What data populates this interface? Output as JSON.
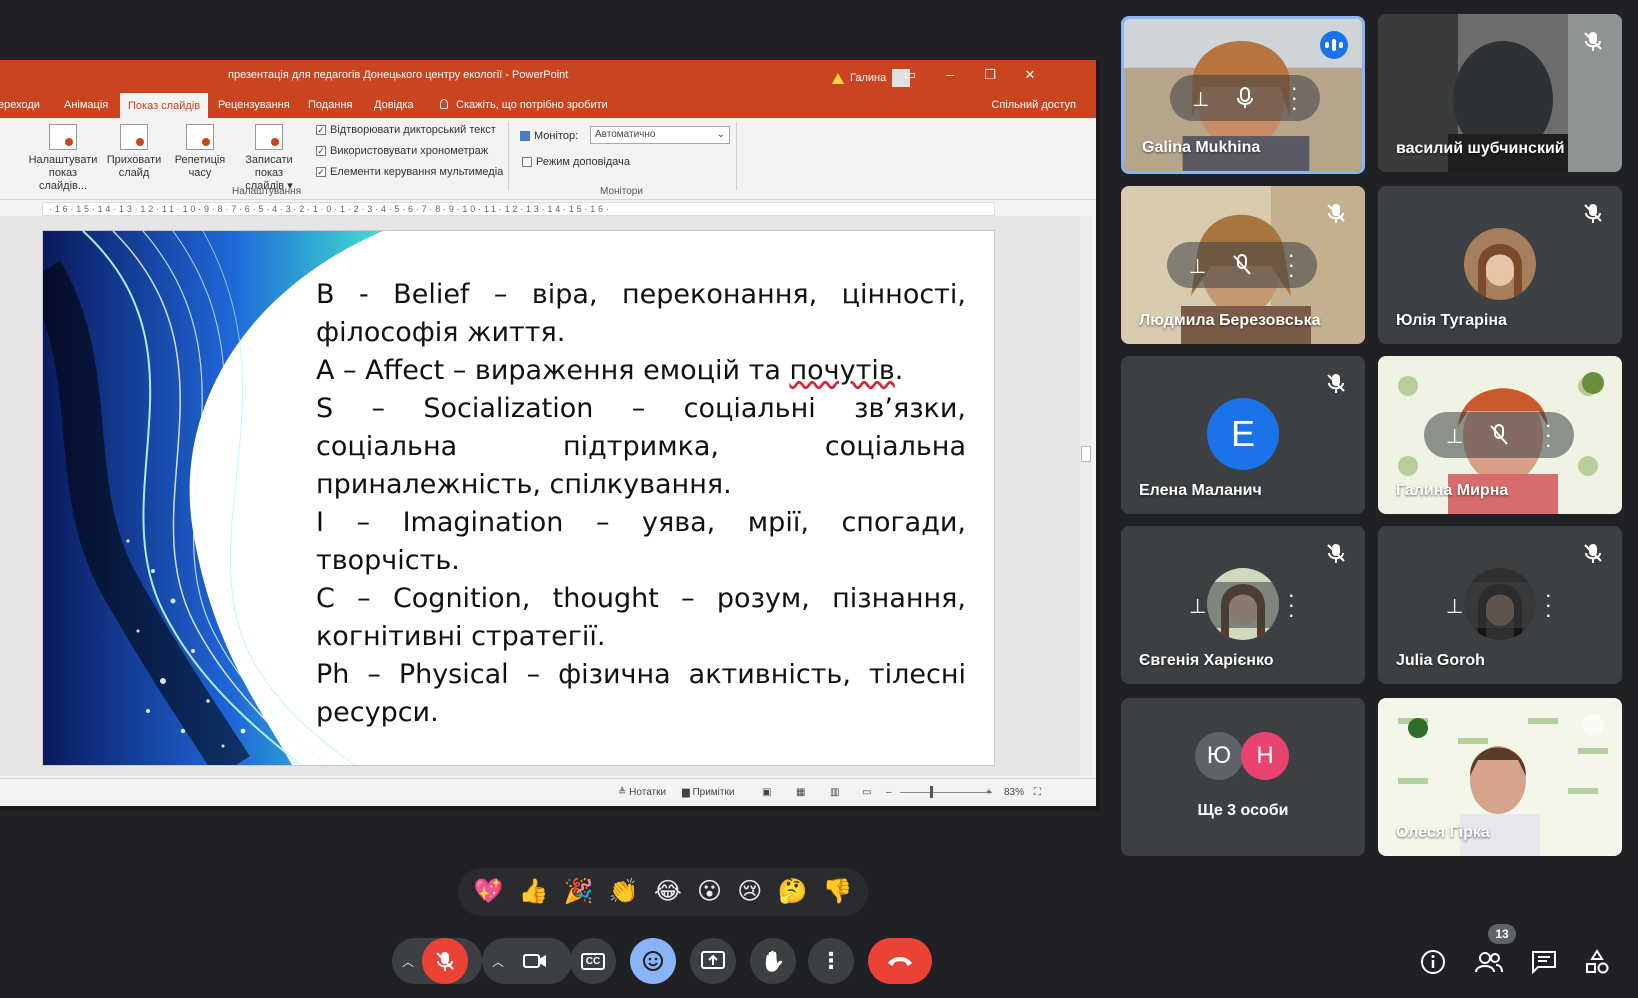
{
  "ppt": {
    "title": "презентація для педагогів Донецького центру екології - PowerPoint",
    "warning_icon": "warning-icon",
    "user_name": "Галина",
    "tabs": [
      "ереходи",
      "Анімація",
      "Показ слайдів",
      "Рецензування",
      "Подання",
      "Довідка"
    ],
    "active_tab": "Показ слайдів",
    "tell_me": "Скажіть, що потрібно зробити",
    "share": "Спільний доступ",
    "ribbon": {
      "buttons": [
        {
          "line1": "Налаштувати",
          "line2": "показ слайдів..."
        },
        {
          "line1": "Приховати",
          "line2": "слайд"
        },
        {
          "line1": "Репетиція",
          "line2": "часу"
        },
        {
          "line1": "Записати показ",
          "line2": "слайдів ▾"
        }
      ],
      "checks": [
        "Відтворювати дикторський текст",
        "Використовувати хронометраж",
        "Елементи керування мультимедіа"
      ],
      "group_setup": "Налаштування",
      "monitor_label": "Монітор:",
      "monitor_value": "Автоматично",
      "presenter_mode": "Режим доповідача",
      "group_monitors": "Монітори"
    },
    "ruler": "·16·15·14·13·12·11·10·9·8·7·6·5·4·3·2·1·0·1·2·3·4·5·6·7·8·9·10·11·12·13·14·15·16·",
    "slide": {
      "p1": "B - Belief – віра, переконання, цінності, філософія життя.",
      "p2a": "A – Affect – вираження емоцій та ",
      "p2b": "почутів",
      "p2c": ".",
      "p3": "S – Socialization – соціальні зв’язки, соціальна підтримка, соціальна приналежність, спілкування.",
      "p4": "I – Imagination – уява, мрії, спогади, творчість.",
      "p5": "C – Cognition, thought – розум, пізнання, когнітивні стратегії.",
      "p6": "Ph – Physical – фізична активність, тілесні ресурси."
    },
    "status": {
      "notes": "Нотатки",
      "comments": "Примітки",
      "zoom_minus": "–",
      "zoom_plus": "+",
      "zoom": "83%"
    }
  },
  "participants": [
    {
      "name": "Galina Mukhina",
      "state": "speaking"
    },
    {
      "name": "василий шубчинский",
      "state": "muted"
    },
    {
      "name": "Людмила Березовська",
      "state": "muted"
    },
    {
      "name": "Юлія Тугаріна",
      "state": "muted"
    },
    {
      "name": "Елена Маланич",
      "state": "muted",
      "initial": "E",
      "color": "#1a73e8"
    },
    {
      "name": "Галина Мирна",
      "state": "muted"
    },
    {
      "name": "Євгенія Харієнко",
      "state": "muted"
    },
    {
      "name": "Julia Goroh",
      "state": "muted"
    },
    {
      "name": "Олеся Гірка",
      "state": "muted"
    }
  ],
  "more_tile": {
    "label": "Ще 3 особи",
    "avatars": [
      {
        "initial": "Ю",
        "color": "#5f6368"
      },
      {
        "initial": "Н",
        "color": "#e8436d"
      }
    ]
  },
  "reactions": [
    "💖",
    "👍",
    "🎉",
    "👏",
    "😂",
    "😮",
    "😢",
    "🤔",
    "👎"
  ],
  "controls": {
    "mic": "mic-off-icon",
    "camera": "camera-icon",
    "captions": "CC",
    "emoji": "emoji-icon",
    "present": "present-icon",
    "hand": "✋",
    "more": "⋮",
    "leave": "leave-call-icon"
  },
  "side": {
    "people_count": "13",
    "info": "info-icon",
    "people": "people-icon",
    "chat": "chat-icon",
    "activities": "activities-icon"
  },
  "colors": {
    "ppt_accent": "#c9441f",
    "meet_bg": "#202124",
    "tile_bg": "#3c4043",
    "leave_red": "#ea4335",
    "active_blue": "#8ab4f8"
  }
}
